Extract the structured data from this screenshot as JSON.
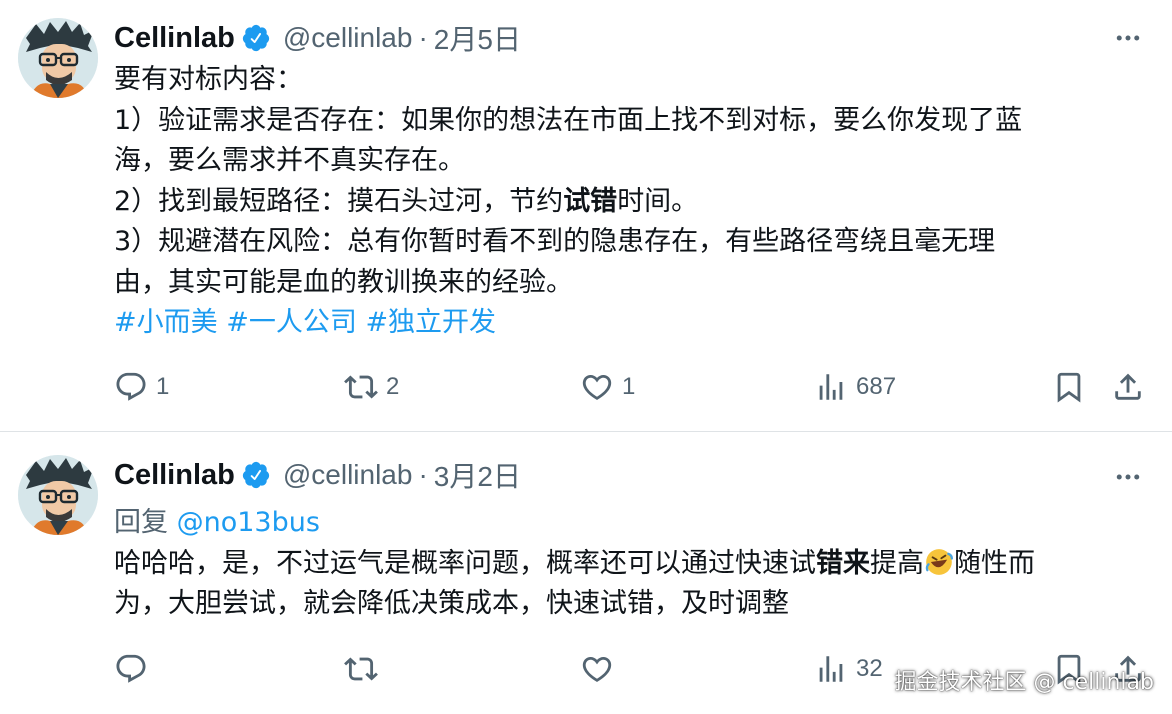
{
  "colors": {
    "accent": "#1d9bf0",
    "muted": "#536471",
    "text": "#0f1419",
    "divider": "#dfe3e6"
  },
  "tweets": [
    {
      "name": "Cellinlab",
      "handle": "@cellinlab",
      "dot": "·",
      "date": "2月5日",
      "lines": {
        "l1": "要有对标内容：",
        "l2": "1）验证需求是否存在：如果你的想法在市面上找不到对标，要么你发现了蓝",
        "l3": "海，要么需求并不真实存在。",
        "l4a": "2）找到最短路径：摸石头过河，节约",
        "l4b": "试错",
        "l4c": "时间。",
        "l5": "3）规避潜在风险：总有你暂时看不到的隐患存在，有些路径弯绕且毫无理",
        "l6": "由，其实可能是血的教训换来的经验。"
      },
      "hashtags": [
        "#小而美",
        "#一人公司",
        "#独立开发"
      ],
      "stats": {
        "replies": "1",
        "retweets": "2",
        "likes": "1",
        "views": "687"
      }
    },
    {
      "name": "Cellinlab",
      "handle": "@cellinlab",
      "dot": "·",
      "date": "3月2日",
      "reply_label": "回复",
      "reply_to": "@no13bus",
      "lines": {
        "l1a": "哈哈哈，是，不过运气是概率问题，概率还可以通过快速试",
        "l1b": "错来",
        "l1c": "提高",
        "l1d": "随性而",
        "l2": "为，大胆尝试，就会降低决策成本，快速试错，及时调整"
      },
      "emoji": "rolling-on-floor-laughing",
      "stats": {
        "views": "32"
      }
    }
  ],
  "watermark": "掘金技术社区 @ cellinlab"
}
